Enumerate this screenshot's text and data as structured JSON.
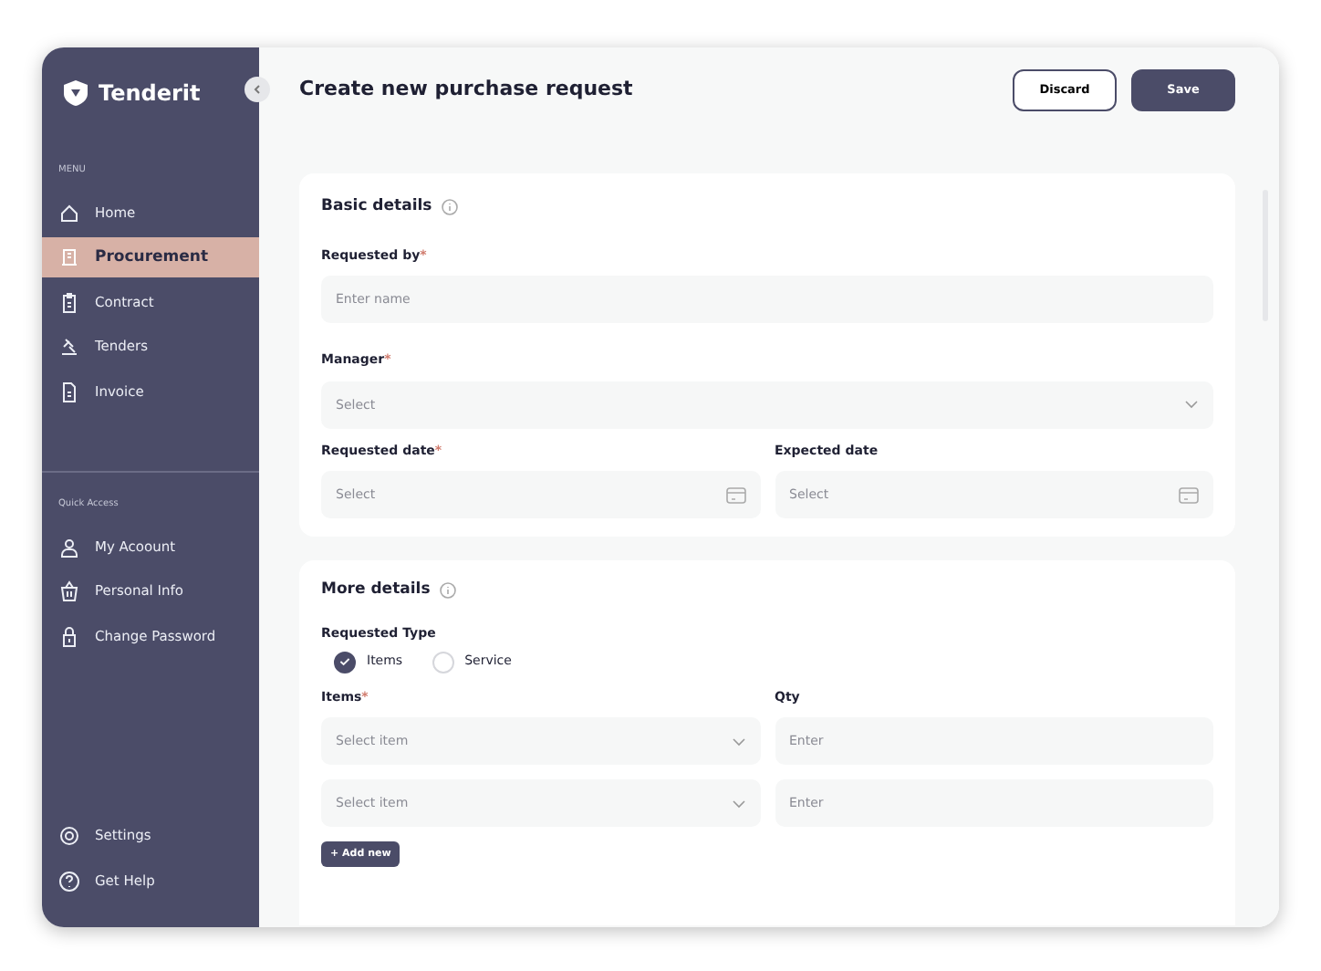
{
  "brand": {
    "name": "Tenderit"
  },
  "sidebar": {
    "menu_heading": "MENU",
    "items": [
      {
        "label": "Home",
        "selected": false
      },
      {
        "label": "Procurement",
        "selected": true
      },
      {
        "label": "Contract",
        "selected": false
      },
      {
        "label": "Tenders",
        "selected": false
      },
      {
        "label": "Invoice",
        "selected": false
      }
    ],
    "quick_heading": "Quick Access",
    "quick_items": [
      {
        "label": "My Acoount"
      },
      {
        "label": "Personal Info"
      },
      {
        "label": "Change Password"
      }
    ],
    "bottom_items": [
      {
        "label": "Settings"
      },
      {
        "label": "Get Help"
      }
    ]
  },
  "header": {
    "title": "Create new purchase request",
    "buttons": [
      {
        "label": "Discard",
        "kind": "outline"
      },
      {
        "label": "Save",
        "kind": "solid"
      }
    ]
  },
  "basic": {
    "title": "Basic details",
    "rows": [
      [
        {
          "label": "Requested by",
          "mark": "*",
          "placeholder": "Enter name",
          "kind": "text"
        }
      ],
      [
        {
          "label": "Manager",
          "mark": "*",
          "placeholder": "Select",
          "kind": "select"
        }
      ],
      [
        {
          "label": "Requested date",
          "mark": "*",
          "placeholder": "Select",
          "kind": "date"
        },
        {
          "label": "Expected date",
          "placeholder": "Select",
          "kind": "date"
        }
      ]
    ]
  },
  "more": {
    "title": "More details",
    "type_label": "Requested Type",
    "types": [
      {
        "label": "Items",
        "selected": true
      },
      {
        "label": "Service",
        "selected": false
      }
    ],
    "items_label": "Items",
    "items_mark": "*",
    "qty_label": "Qty",
    "lines": [
      {
        "item_placeholder": "Select item",
        "qty_placeholder": "Enter"
      },
      {
        "item_placeholder": "Select item",
        "qty_placeholder": "Enter"
      }
    ],
    "add_button": {
      "icon": "+",
      "label": "Add new"
    }
  }
}
